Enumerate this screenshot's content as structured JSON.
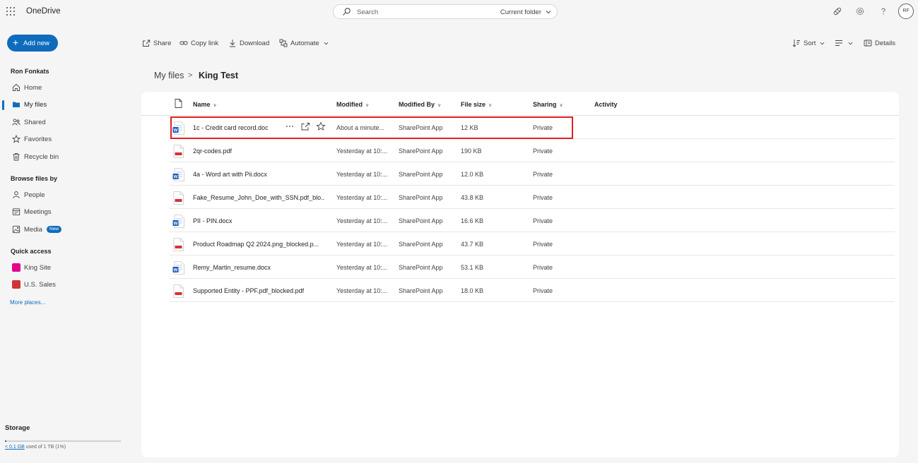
{
  "app": {
    "title": "OneDrive"
  },
  "search": {
    "placeholder": "Search",
    "scope": "Current folder"
  },
  "user": {
    "initials": "RF",
    "name": "Ron Fonkats"
  },
  "nav": {
    "add_new": "Add new",
    "items": [
      {
        "label": "Home",
        "icon": "home-icon"
      },
      {
        "label": "My files",
        "icon": "folder-icon",
        "active": true
      },
      {
        "label": "Shared",
        "icon": "people-icon"
      },
      {
        "label": "Favorites",
        "icon": "star-icon"
      },
      {
        "label": "Recycle bin",
        "icon": "trash-icon"
      }
    ],
    "browse_title": "Browse files by",
    "browse": [
      {
        "label": "People",
        "icon": "person-icon"
      },
      {
        "label": "Meetings",
        "icon": "calendar-icon"
      },
      {
        "label": "Media",
        "icon": "image-icon",
        "badge": "New"
      }
    ],
    "quick_title": "Quick access",
    "quick": [
      {
        "label": "King Site",
        "color": "#e3008c"
      },
      {
        "label": "U.S. Sales",
        "color": "#d13438"
      }
    ],
    "more_places": "More places..."
  },
  "storage": {
    "title": "Storage",
    "used_link": "< 0.1 GB",
    "used_rest": " used of 1 TB (1%)",
    "fraction": 0.01
  },
  "commands": {
    "share": "Share",
    "copy_link": "Copy link",
    "download": "Download",
    "automate": "Automate",
    "sort": "Sort",
    "details": "Details"
  },
  "breadcrumb": {
    "root": "My files",
    "separator": ">",
    "current": "King Test"
  },
  "table": {
    "headers": {
      "name": "Name",
      "modified": "Modified",
      "modified_by": "Modified By",
      "file_size": "File size",
      "sharing": "Sharing",
      "activity": "Activity"
    },
    "rows": [
      {
        "name": "1c - Credit card record.doc",
        "type": "word",
        "modified": "About a minute...",
        "modified_by": "SharePoint App",
        "size": "12 KB",
        "sharing": "Private",
        "selected": true
      },
      {
        "name": "2qr-codes.pdf",
        "type": "pdf",
        "modified": "Yesterday at 10:...",
        "modified_by": "SharePoint App",
        "size": "190 KB",
        "sharing": "Private"
      },
      {
        "name": "4a - Word art with Pii.docx",
        "type": "word",
        "modified": "Yesterday at 10:...",
        "modified_by": "SharePoint App",
        "size": "12.0 KB",
        "sharing": "Private"
      },
      {
        "name": "Fake_Resume_John_Doe_with_SSN.pdf_blo...",
        "type": "pdf",
        "modified": "Yesterday at 10:...",
        "modified_by": "SharePoint App",
        "size": "43.8 KB",
        "sharing": "Private"
      },
      {
        "name": "PII - PIN.docx",
        "type": "word",
        "modified": "Yesterday at 10:...",
        "modified_by": "SharePoint App",
        "size": "16.6 KB",
        "sharing": "Private"
      },
      {
        "name": "Product Roadmap Q2 2024.png_blocked.p...",
        "type": "pdf",
        "modified": "Yesterday at 10:...",
        "modified_by": "SharePoint App",
        "size": "43.7 KB",
        "sharing": "Private"
      },
      {
        "name": "Remy_Martin_resume.docx",
        "type": "word",
        "modified": "Yesterday at 10:...",
        "modified_by": "SharePoint App",
        "size": "53.1 KB",
        "sharing": "Private"
      },
      {
        "name": "Supported Entity - PPF.pdf_blocked.pdf",
        "type": "pdf",
        "modified": "Yesterday at 10:...",
        "modified_by": "SharePoint App",
        "size": "18.0 KB",
        "sharing": "Private"
      }
    ]
  },
  "colors": {
    "accent": "#0f6cbd",
    "highlight": "#e02020",
    "word": "#185abd",
    "pdf": "#d13438"
  }
}
